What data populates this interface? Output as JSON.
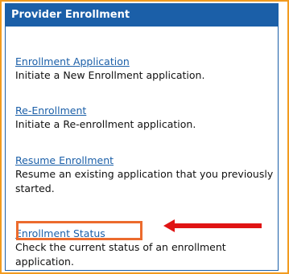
{
  "panel": {
    "title": "Provider Enrollment",
    "items": [
      {
        "link": "Enrollment Application",
        "description": "Initiate a New Enrollment application."
      },
      {
        "link": "Re-Enrollment",
        "description": "Initiate a Re-enrollment application."
      },
      {
        "link": "Resume Enrollment",
        "description": "Resume an existing application that you previously started."
      },
      {
        "link": "Enrollment Status",
        "description": "Check the current status of an enrollment application."
      }
    ]
  },
  "colors": {
    "header_bg": "#1b5fa8",
    "link": "#1b5fa8",
    "outer_frame": "#f29b1f",
    "highlight_box": "#ec6b2d",
    "arrow": "#e01414"
  }
}
